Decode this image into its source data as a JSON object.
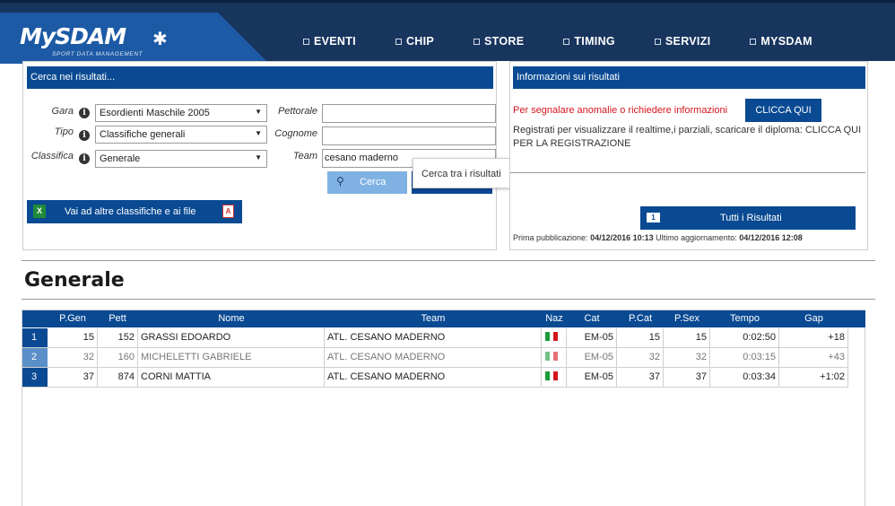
{
  "brand": {
    "name": "MySDAM",
    "tagline": "SPORT DATA MANAGEMENT"
  },
  "nav": [
    {
      "label": "EVENTI"
    },
    {
      "label": "CHIP"
    },
    {
      "label": "STORE"
    },
    {
      "label": "TIMING"
    },
    {
      "label": "SERVIZI"
    },
    {
      "label": "MYSDAM"
    }
  ],
  "search": {
    "title": "Cerca nei risultati...",
    "gara_label": "Gara",
    "gara_value": "Esordienti Maschile 2005",
    "tipo_label": "Tipo",
    "tipo_value": "Classifiche generali",
    "classifica_label": "Classifica",
    "classifica_value": "Generale",
    "pettorale_label": "Pettorale",
    "pettorale_value": "",
    "cognome_label": "Cognome",
    "cognome_value": "",
    "team_label": "Team",
    "team_value": "cesano maderno",
    "cerca_label": "Cerca",
    "tooltip": "Cerca tra i risultati",
    "altre_label": "Vai ad altre classifiche e ai file"
  },
  "info": {
    "title": "Informazioni sui risultati",
    "report_text": "Per segnalare anomalie o richiedere informazioni",
    "clicca_label": "CLICCA QUI",
    "register_text": "Registrati per visualizzare il realtime,i parziali, scaricare il diploma: CLICCA QUI PER LA REGISTRAZIONE",
    "tutti_label": "Tutti i Risultati",
    "prima_label": "Prima pubblicazione:",
    "prima_value": "04/12/2016 10:13",
    "ultimo_label": "Ultimo aggiornamento:",
    "ultimo_value": "04/12/2016 12:08"
  },
  "section_title": "Generale",
  "table": {
    "headers": [
      "P.Gen",
      "Pett",
      "Nome",
      "Team",
      "Naz",
      "Cat",
      "P.Cat",
      "P.Sex",
      "Tempo",
      "Gap"
    ],
    "rows": [
      {
        "rank": "1",
        "pgen": "15",
        "pett": "152",
        "nome": "GRASSI EDOARDO",
        "team": "ATL. CESANO MADERNO",
        "naz": "italy-flag",
        "cat": "EM-05",
        "pcat": "15",
        "psex": "15",
        "tempo": "0:02:50",
        "gap": "+18"
      },
      {
        "rank": "2",
        "pgen": "32",
        "pett": "160",
        "nome": "MICHELETTI GABRIELE",
        "team": "ATL. CESANO MADERNO",
        "naz": "italy-flag",
        "cat": "EM-05",
        "pcat": "32",
        "psex": "32",
        "tempo": "0:03:15",
        "gap": "+43"
      },
      {
        "rank": "3",
        "pgen": "37",
        "pett": "874",
        "nome": "CORNI MATTIA",
        "team": "ATL. CESANO MADERNO",
        "naz": "italy-flag",
        "cat": "EM-05",
        "pcat": "37",
        "psex": "37",
        "tempo": "0:03:34",
        "gap": "+1:02"
      }
    ]
  },
  "colors": {
    "brand_blue": "#0a4a93",
    "header_navy": "#18355e",
    "alert_red": "#d3161c"
  }
}
